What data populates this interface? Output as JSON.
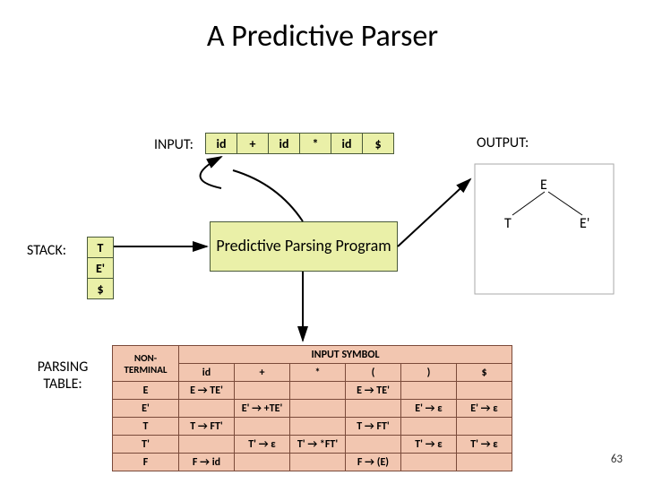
{
  "title": "A Predictive Parser",
  "labels": {
    "input": "INPUT:",
    "output": "OUTPUT:",
    "stack": "STACK:",
    "parsing_table": "PARSING TABLE:"
  },
  "input_tape": [
    "id",
    "+",
    "id",
    "*",
    "id",
    "$"
  ],
  "stack_cells": [
    "T",
    "E'",
    "$"
  ],
  "pp_box": "Predictive Parsing Program",
  "tree": {
    "root": "E",
    "left": "T",
    "right": "E'"
  },
  "table": {
    "header_nt": "NON-TERMINAL",
    "header_sym": "INPUT SYMBOL",
    "columns": [
      "id",
      "+",
      "*",
      "(",
      ")",
      "$"
    ],
    "rows": [
      {
        "nt": "E",
        "cells": [
          "E → TE'",
          "",
          "",
          "E → TE'",
          "",
          ""
        ]
      },
      {
        "nt": "E'",
        "cells": [
          "",
          "E' → +TE'",
          "",
          "",
          "E' → ε",
          "E' → ε"
        ]
      },
      {
        "nt": "T",
        "cells": [
          "T → FT'",
          "",
          "",
          "T → FT'",
          "",
          ""
        ]
      },
      {
        "nt": "T'",
        "cells": [
          "",
          "T' → ε",
          "T' → *FT'",
          "",
          "T' → ε",
          "T' → ε"
        ]
      },
      {
        "nt": "F",
        "cells": [
          "F → id",
          "",
          "",
          "F → (E)",
          "",
          ""
        ]
      }
    ]
  },
  "page_number": "63"
}
